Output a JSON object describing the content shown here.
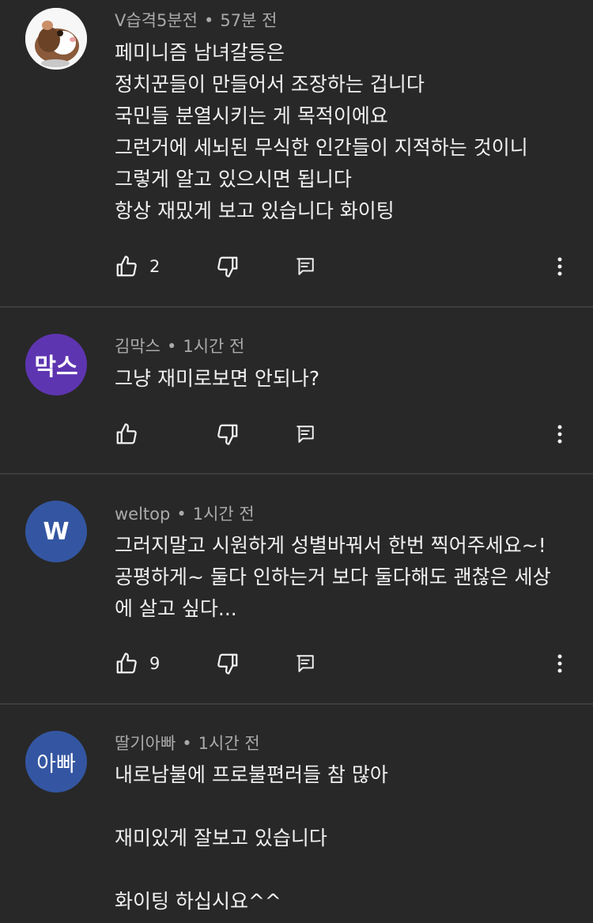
{
  "comments": [
    {
      "author": "V습격5분전",
      "time": "57분 전",
      "avatar_text": "",
      "avatar_color": "#f5f5f5",
      "lines": [
        "페미니즘 남녀갈등은",
        "정치꾼들이 만들어서 조장하는 겁니다",
        "국민들 분열시키는 게 목적이에요",
        "그런거에 세뇌된 무식한 인간들이 지적하는 것이니",
        "그렇게 알고 있으시면 됩니다",
        "항상 재밌게 보고 있습니다 화이팅"
      ],
      "likes": "2"
    },
    {
      "author": "김막스",
      "time": "1시간 전",
      "avatar_text": "막스",
      "avatar_color": "#5e35b1",
      "lines": [
        "그냥 재미로보면 안되나?"
      ],
      "likes": ""
    },
    {
      "author": "weltop",
      "time": "1시간 전",
      "avatar_text": "W",
      "avatar_color": "#3456a2",
      "lines": [
        "그러지말고 시원하게 성별바꿔서 한번 찍어주세요~!",
        "공평하게~ 둘다 인하는거 보다 둘다해도 괜찮은 세상",
        "에 살고 싶다..."
      ],
      "likes": "9"
    },
    {
      "author": "딸기아빠",
      "time": "1시간 전",
      "avatar_text": "아빠",
      "avatar_color": "#3456a2",
      "lines": [
        "내로남불에 프로불편러들 참 많아",
        "",
        "재미있게 잘보고 있습니다",
        "",
        "화이팅 하십시요^^"
      ],
      "likes": ""
    }
  ],
  "separator": "•",
  "icons": {
    "like": "thumb-up-icon",
    "dislike": "thumb-down-icon",
    "reply": "reply-icon",
    "more": "more-vertical-icon"
  }
}
